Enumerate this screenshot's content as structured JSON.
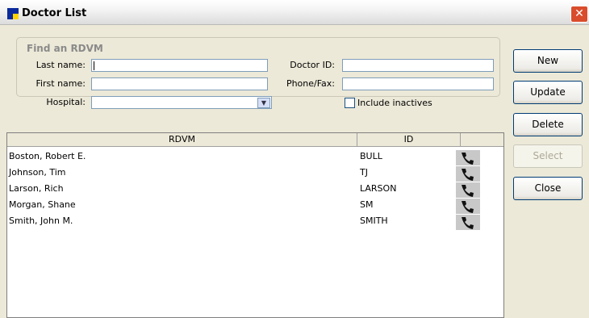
{
  "window": {
    "title": "Doctor List"
  },
  "find": {
    "legend": "Find an RDVM",
    "last_name_label": "Last name:",
    "first_name_label": "First name:",
    "hospital_label": "Hospital:",
    "doctor_id_label": "Doctor ID:",
    "phone_fax_label": "Phone/Fax:",
    "include_inactives_label": "Include inactives",
    "include_inactives_checked": false,
    "last_name_value": "",
    "first_name_value": "",
    "hospital_value": "",
    "doctor_id_value": "",
    "phone_fax_value": ""
  },
  "buttons": {
    "new": "New",
    "update": "Update",
    "delete": "Delete",
    "select": "Select",
    "close": "Close"
  },
  "table": {
    "columns": [
      "RDVM",
      "ID"
    ],
    "rows": [
      {
        "rdvm": "Boston, Robert  E.",
        "id": "BULL"
      },
      {
        "rdvm": "Johnson, Tim",
        "id": "TJ"
      },
      {
        "rdvm": "Larson, Rich",
        "id": "LARSON"
      },
      {
        "rdvm": "Morgan, Shane",
        "id": "SM"
      },
      {
        "rdvm": "Smith, John  M.",
        "id": "SMITH"
      }
    ]
  },
  "icons": {
    "row_action": "phone-icon",
    "dropdown": "chevron-down-icon",
    "window_close": "close-icon"
  },
  "colors": {
    "titlebar_close": "#d94c2c",
    "window_bg": "#ECE9D8",
    "input_border": "#7f9db9"
  }
}
